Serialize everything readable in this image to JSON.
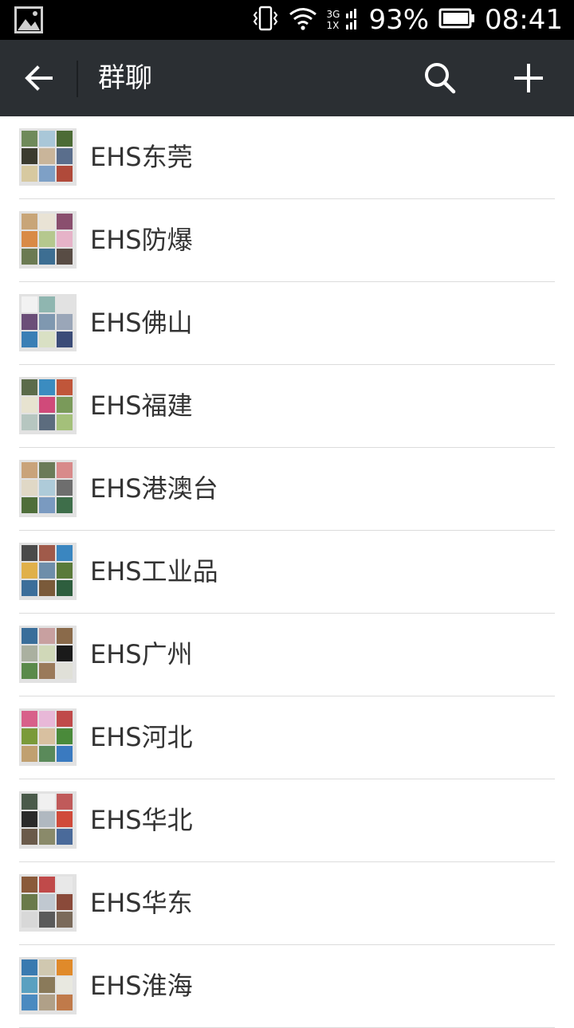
{
  "status_bar": {
    "network_top": "3G",
    "network_bottom": "1X",
    "battery": "93%",
    "time": "08:41"
  },
  "toolbar": {
    "title": "群聊"
  },
  "groups": [
    {
      "name": "EHS东莞",
      "tiles": [
        "#6f8a5a",
        "#a9c7d8",
        "#4c6b35",
        "#3b3b2f",
        "#c9b59a",
        "#5a6e8c",
        "#d7c9a0",
        "#7ea0c6",
        "#b04a3a"
      ]
    },
    {
      "name": "EHS防爆",
      "tiles": [
        "#c8a578",
        "#e9e3d5",
        "#8a4f6e",
        "#d98a46",
        "#b5c88e",
        "#e6b3c8",
        "#6b7a52",
        "#3d6e92",
        "#584c44"
      ]
    },
    {
      "name": "EHS佛山",
      "tiles": [
        "#f2f2f2",
        "#8fb6b0",
        "#e2e2e2",
        "#6b4e78",
        "#7f98b0",
        "#9aa6b8",
        "#3a7fb5",
        "#d9e0c4",
        "#3b4c78"
      ]
    },
    {
      "name": "EHS福建",
      "tiles": [
        "#5b6b4a",
        "#3b8cc0",
        "#c0563a",
        "#e7e3d0",
        "#d04a7a",
        "#7a9a5a",
        "#b6c6c0",
        "#5c6c7e",
        "#a4c07a"
      ]
    },
    {
      "name": "EHS港澳台",
      "tiles": [
        "#c9a37a",
        "#6b7b58",
        "#d88a8a",
        "#e0d8c6",
        "#aecbd9",
        "#6e6e6e",
        "#4f6e3a",
        "#7a9ac0",
        "#3e6e4a"
      ]
    },
    {
      "name": "EHS工业品",
      "tiles": [
        "#4a4a4a",
        "#a05a4a",
        "#3a86c0",
        "#e0b04a",
        "#6e8eaa",
        "#5a7a3a",
        "#3c6e9a",
        "#7a5a3a",
        "#2e5e3e"
      ]
    },
    {
      "name": "EHS广州",
      "tiles": [
        "#3a6e9a",
        "#c8a0a0",
        "#8a6a4a",
        "#aab0a0",
        "#d0d8b8",
        "#1a1a1a",
        "#5a8a4a",
        "#9a7a5a",
        "#e0e0d8"
      ]
    },
    {
      "name": "EHS河北",
      "tiles": [
        "#d8608a",
        "#e8b8d8",
        "#c04a4a",
        "#7a9a3a",
        "#d8c0a0",
        "#4a8a3a",
        "#c0a070",
        "#5a8a5a",
        "#3a7ac0"
      ]
    },
    {
      "name": "EHS华北",
      "tiles": [
        "#4a5a4a",
        "#f0f0f0",
        "#c05a5a",
        "#2a2a2a",
        "#b0b8c0",
        "#d04a3a",
        "#6a5a4a",
        "#8a8a6a",
        "#4a6a9a"
      ]
    },
    {
      "name": "EHS华东",
      "tiles": [
        "#8a5a3a",
        "#c04a4a",
        "#e8e8e8",
        "#6a7a4a",
        "#c0c8d0",
        "#8a4a3a",
        "#d8d8d8",
        "#5a5a5a",
        "#7a6a5a"
      ]
    },
    {
      "name": "EHS淮海",
      "tiles": [
        "#3a7ab0",
        "#d0c8b0",
        "#e08a2a",
        "#5aa0c0",
        "#8a7a5a",
        "#e8e8e0",
        "#4a8ac0",
        "#b0a088",
        "#c07a4a"
      ]
    }
  ]
}
